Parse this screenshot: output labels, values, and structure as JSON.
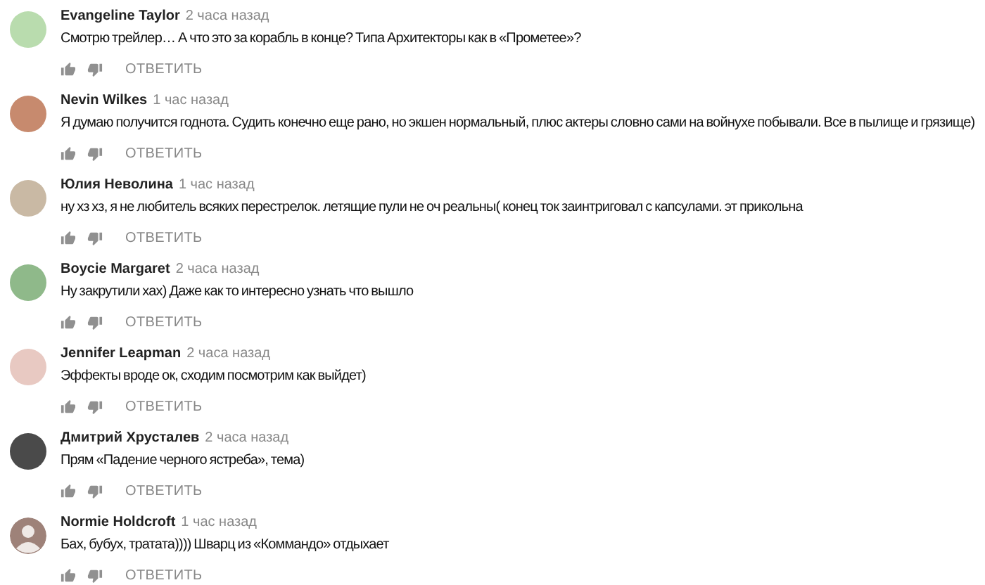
{
  "comments": [
    {
      "author": "Evangeline Taylor",
      "time": "2 часа назад",
      "text": "Смотрю трейлер… А что это за корабль в конце? Типа Архитекторы как в «Прометее»?",
      "reply": "ОТВЕТИТЬ",
      "avatar": {
        "kind": "photo",
        "color": "#b9dcae"
      }
    },
    {
      "author": "Nevin Wilkes",
      "time": "1 час назад",
      "text": "Я думаю получится годнота. Судить конечно еще рано, но экшен нормальный, плюс актеры словно сами на войнухе побывали. Все в пылище и грязище)",
      "reply": "ОТВЕТИТЬ",
      "avatar": {
        "kind": "photo",
        "color": "#c78a6e"
      }
    },
    {
      "author": "Юлия Неволина",
      "time": "1 час назад",
      "text": "ну хз хз,  я не любитель всяких перестрелок. летящие пули не оч реальны( конец ток заинтриговал с капсулами. эт прикольна",
      "reply": "ОТВЕТИТЬ",
      "avatar": {
        "kind": "photo",
        "color": "#c9b9a4"
      }
    },
    {
      "author": "Boycie Margaret",
      "time": "2 часа назад",
      "text": "Ну закрутили хах) Даже как то интересно узнать что вышло",
      "reply": "ОТВЕТИТЬ",
      "avatar": {
        "kind": "photo",
        "color": "#8fb98a"
      }
    },
    {
      "author": "Jennifer Leapman",
      "time": "2 часа назад",
      "text": "Эффекты вроде ок, сходим посмотрим как выйдет)",
      "reply": "ОТВЕТИТЬ",
      "avatar": {
        "kind": "photo",
        "color": "#e8c9c2"
      }
    },
    {
      "author": "Дмитрий Хрусталев",
      "time": "2 часа назад",
      "text": "Прям «Падение черного ястреба», тема)",
      "reply": "ОТВЕТИТЬ",
      "avatar": {
        "kind": "photo",
        "color": "#4a4a4a"
      }
    },
    {
      "author": "Normie Holdcroft",
      "time": "1 час назад",
      "text": "Бах, бубух, тратата)))) Шварц из «Коммандо» отдыхает",
      "reply": "ОТВЕТИТЬ",
      "avatar": {
        "kind": "default",
        "color": "#9e8279"
      }
    }
  ]
}
